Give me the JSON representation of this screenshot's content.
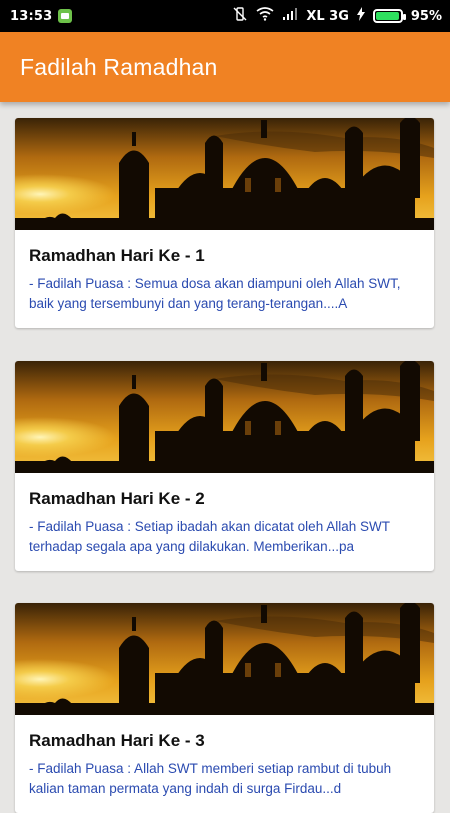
{
  "status_bar": {
    "time": "13:53",
    "network": "XL 3G",
    "battery": "95%"
  },
  "app_bar": {
    "title": "Fadilah Ramadhan"
  },
  "cards": [
    {
      "title": "Ramadhan Hari Ke - 1",
      "description": "- Fadilah Puasa : Semua dosa akan diampuni oleh Allah SWT, baik yang tersembunyi dan yang terang-terangan....A"
    },
    {
      "title": "Ramadhan Hari Ke - 2",
      "description": "- Fadilah Puasa : Setiap ibadah akan dicatat oleh Allah SWT terhadap segala apa yang dilakukan. Memberikan...pa"
    },
    {
      "title": "Ramadhan Hari Ke - 3",
      "description": "- Fadilah Puasa : Allah SWT memberi setiap rambut di tubuh kalian taman permata yang indah di surga Firdau...d"
    }
  ],
  "colors": {
    "app_bar": "#f08223",
    "description_text": "#2b4bb0",
    "background": "#e7e6e4"
  }
}
